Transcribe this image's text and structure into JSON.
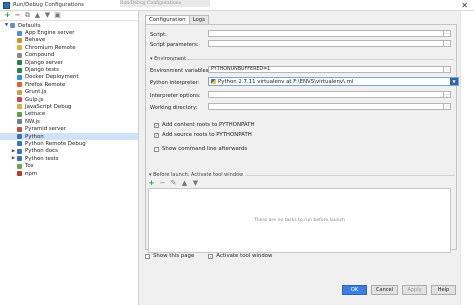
{
  "window": {
    "title": "Run/Debug Configurations",
    "close_glyph": "✕"
  },
  "background_text": "Run/Debug Configurations",
  "toolbar": {
    "add": "+",
    "remove": "−",
    "copy": "⧉",
    "up": "▲",
    "down": "▼",
    "folder": "▣"
  },
  "tree": [
    {
      "label": "Defaults",
      "level": 0,
      "expanded": true,
      "icon_color": "#6b8fc9",
      "selected": false,
      "has_arrow": true
    },
    {
      "label": "App Engine server",
      "level": 1,
      "icon_color": "#4a90d9",
      "selected": false,
      "has_arrow": false
    },
    {
      "label": "Behave",
      "level": 1,
      "icon_color": "#d98c2e",
      "selected": false,
      "has_arrow": false
    },
    {
      "label": "Chromium Remote",
      "level": 1,
      "icon_color": "#e2b23a",
      "selected": false,
      "has_arrow": false
    },
    {
      "label": "Compound",
      "level": 1,
      "icon_color": "#8a8a8a",
      "selected": false,
      "has_arrow": false
    },
    {
      "label": "Django server",
      "level": 1,
      "icon_color": "#2e7d4f",
      "selected": false,
      "has_arrow": false
    },
    {
      "label": "Django tests",
      "level": 1,
      "icon_color": "#2e7d4f",
      "selected": false,
      "has_arrow": false
    },
    {
      "label": "Docker Deployment",
      "level": 1,
      "icon_color": "#2f8fd8",
      "selected": false,
      "has_arrow": false
    },
    {
      "label": "Firefox Remote",
      "level": 1,
      "icon_color": "#e0632a",
      "selected": false,
      "has_arrow": false
    },
    {
      "label": "Grunt.js",
      "level": 1,
      "icon_color": "#c9a24a",
      "selected": false,
      "has_arrow": false
    },
    {
      "label": "Gulp.js",
      "level": 1,
      "icon_color": "#cf4646",
      "selected": false,
      "has_arrow": false
    },
    {
      "label": "JavaScript Debug",
      "level": 1,
      "icon_color": "#d6b13b",
      "selected": false,
      "has_arrow": false
    },
    {
      "label": "Lettuce",
      "level": 1,
      "icon_color": "#5aa34a",
      "selected": false,
      "has_arrow": false
    },
    {
      "label": "NW.js",
      "level": 1,
      "icon_color": "#6f7e8f",
      "selected": false,
      "has_arrow": false
    },
    {
      "label": "Pyramid server",
      "level": 1,
      "icon_color": "#b9533a",
      "selected": false,
      "has_arrow": false
    },
    {
      "label": "Python",
      "level": 1,
      "icon_color": "#3a74b5",
      "selected": true,
      "has_arrow": false
    },
    {
      "label": "Python Remote Debug",
      "level": 1,
      "icon_color": "#3a74b5",
      "selected": false,
      "has_arrow": false
    },
    {
      "label": "Python docs",
      "level": 1,
      "icon_color": "#3a74b5",
      "selected": false,
      "has_arrow": true
    },
    {
      "label": "Python tests",
      "level": 1,
      "icon_color": "#3a74b5",
      "selected": false,
      "has_arrow": true
    },
    {
      "label": "Tox",
      "level": 1,
      "icon_color": "#6aa84f",
      "selected": false,
      "has_arrow": false
    },
    {
      "label": "npm",
      "level": 1,
      "icon_color": "#c0392b",
      "selected": false,
      "has_arrow": false
    }
  ],
  "tabs": [
    {
      "label": "Configuration",
      "active": true
    },
    {
      "label": "Logs",
      "active": false
    }
  ],
  "form": {
    "script_label": "Script:",
    "script_params_label": "Script parameters:",
    "environment_section": "Environment",
    "env_vars_label": "Environment variables:",
    "env_vars_value": "PYTHONUNBUFFERED=1",
    "interpreter_label": "Python interpreter:",
    "interpreter_value": "Python 2.7.11 virtualenv at F:\\ENVS\\virtualenv\\.ml",
    "interp_options_label": "Interpreter options:",
    "working_dir_label": "Working directory:",
    "add_content_roots": "Add content roots to PYTHONPATH",
    "add_source_roots": "Add source roots to PYTHONPATH",
    "show_cmd_line": "Show command line afterwards",
    "dots": "..."
  },
  "checks": {
    "add_content_roots": true,
    "add_source_roots": true,
    "show_cmd_line": false,
    "show_this_page": false,
    "activate_tool_window": true
  },
  "before_launch": {
    "header": "Before launch: Activate tool window",
    "empty_text": "There are no tasks to run before launch"
  },
  "bottom": {
    "show_this_page": "Show this page",
    "activate_tool_window": "Activate tool window"
  },
  "buttons": {
    "ok": "OK",
    "cancel": "Cancel",
    "apply": "Apply",
    "help": "Help"
  },
  "colors": {
    "accent": "#3d7ee3",
    "selection": "#cfe2f7",
    "add_green": "#1a9b3c"
  }
}
